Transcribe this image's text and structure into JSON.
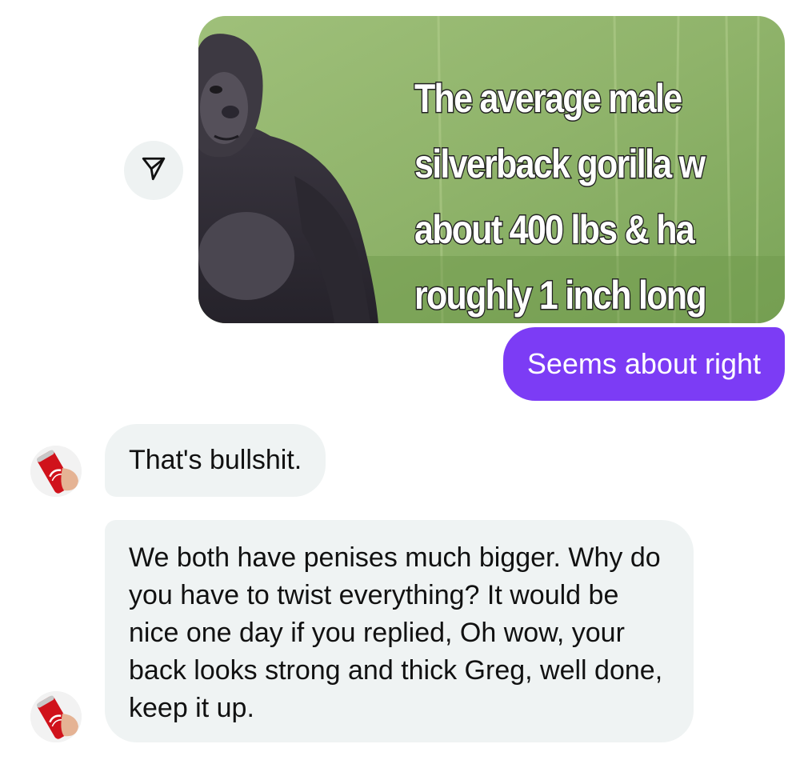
{
  "conversation": {
    "shared_post": {
      "share_icon": "send-icon",
      "image_subject": "gorilla",
      "caption_lines": [
        "The average male",
        "silverback gorilla w",
        "about 400 lbs & ha",
        "roughly 1 inch long"
      ]
    },
    "outgoing_message": "Seems about right",
    "incoming_messages": [
      "That's bullshit.",
      "We both have penises much bigger. Why do you have to twist everything? It would be nice one day if you replied, Oh wow, your back looks strong and thick Greg, well done, keep it up."
    ],
    "avatar_subject": "coca-cola-can-in-hand"
  },
  "colors": {
    "outgoing_bubble": "#7c3cf5",
    "incoming_bubble": "#eff3f3",
    "share_button_bg": "#eef2f2"
  }
}
